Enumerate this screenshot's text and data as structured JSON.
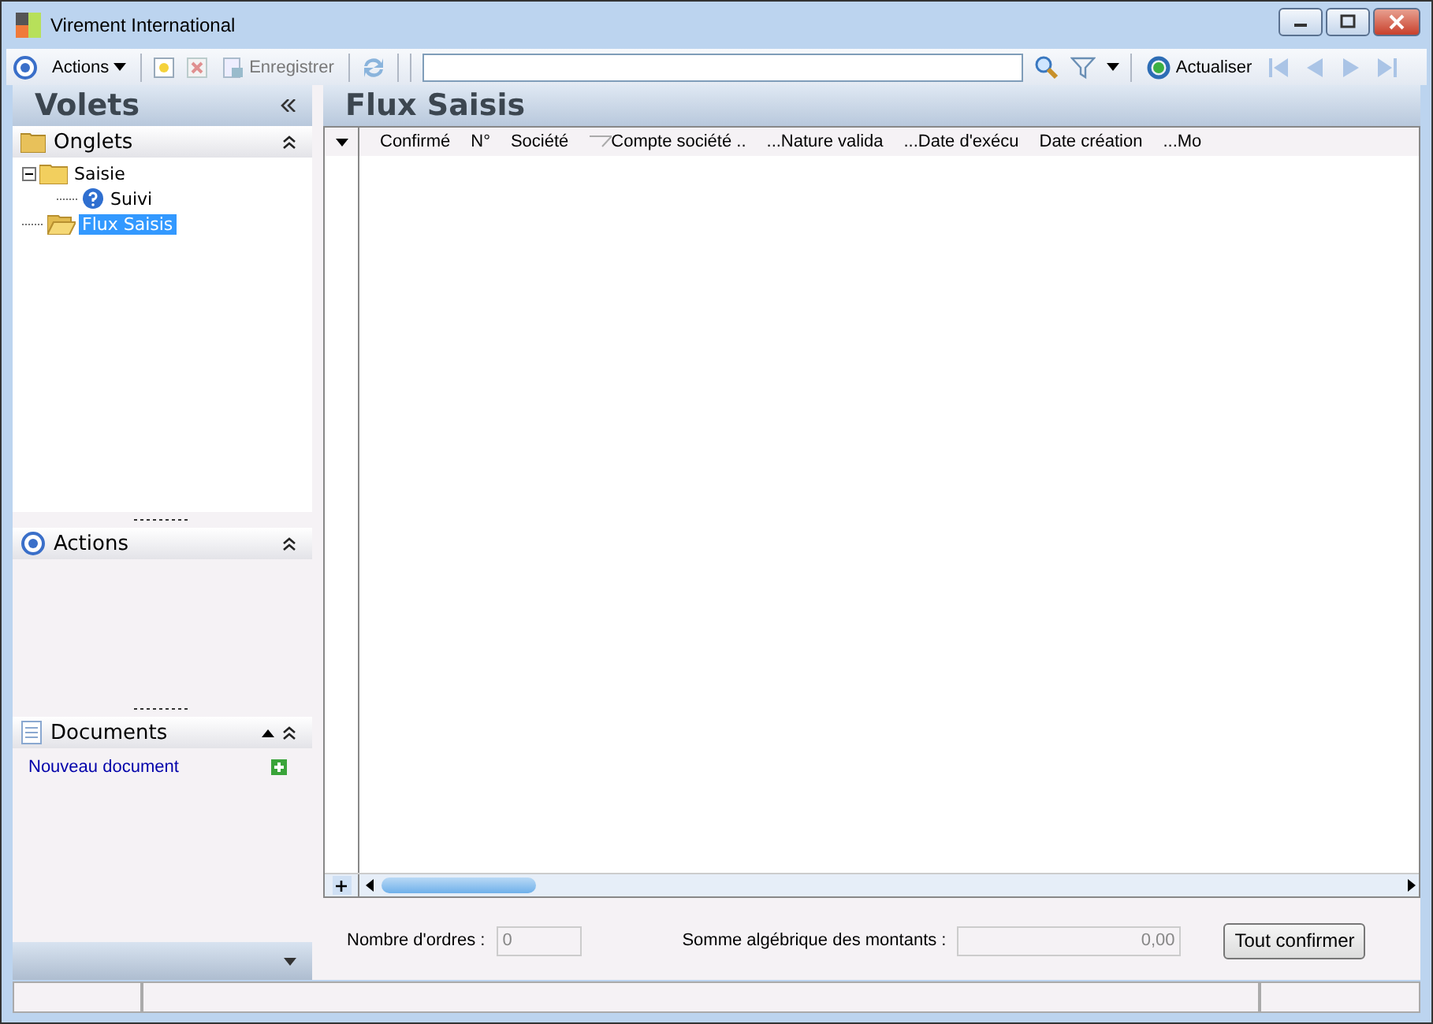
{
  "window": {
    "title": "Virement International"
  },
  "toolbar": {
    "actions_menu": "Actions",
    "save": {
      "label": "Enregistrer",
      "disabled": true
    },
    "refresh": "Actualiser"
  },
  "sidebar": {
    "title": "Volets",
    "panels": [
      {
        "kind": "tree",
        "title": "Onglets",
        "items": [
          {
            "label": "Saisie",
            "selected": false,
            "expanded": true,
            "children": [
              {
                "label": "Suivi",
                "selected": false
              }
            ]
          },
          {
            "label": "Flux Saisis",
            "selected": true
          }
        ]
      },
      {
        "kind": "actions",
        "title": "Actions"
      },
      {
        "kind": "documents",
        "title": "Documents",
        "link": "Nouveau document"
      }
    ]
  },
  "grid": {
    "title": "Flux Saisis",
    "columns": [
      {
        "label": "Confirmé",
        "filter": false
      },
      {
        "label": "N°",
        "filter": false
      },
      {
        "label": "Société",
        "filter": false
      },
      {
        "label": "Compte société ..",
        "filter": true
      },
      {
        "label": "...Nature valida",
        "filter": false
      },
      {
        "label": "...Date d'exécu",
        "filter": false
      },
      {
        "label": "Date création",
        "filter": false
      },
      {
        "label": "...Mo",
        "filter": false
      }
    ]
  },
  "footer": {
    "count_label": "Nombre d'ordres :",
    "count_value": "0",
    "sum_label": "Somme algébrique des montants :",
    "sum_value": "0,00",
    "button": "Tout confirmer"
  }
}
